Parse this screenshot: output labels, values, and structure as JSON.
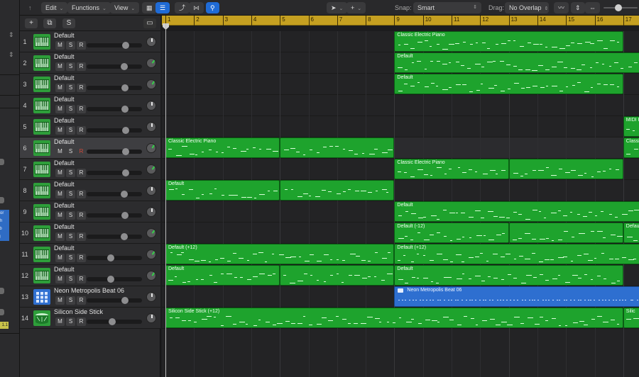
{
  "toolbar": {
    "edit": "Edit",
    "functions": "Functions",
    "view": "View",
    "snap_label": "Snap:",
    "snap_value": "Smart",
    "drag_label": "Drag:",
    "drag_value": "No Overlap"
  },
  "header_bar": {
    "add": "+",
    "duplicate": "⧉",
    "solo": "S"
  },
  "buttons": {
    "mute": "M",
    "solo": "S",
    "record": "R"
  },
  "strip": {
    "blue_labels": [
      "ssor",
      "itch",
      "erb",
      "ng"
    ],
    "yellow_label": "1.1"
  },
  "ruler": {
    "bars": [
      "1",
      "2",
      "3",
      "4",
      "5",
      "6",
      "7",
      "8",
      "9",
      "10",
      "11",
      "12",
      "13",
      "14",
      "15",
      "16",
      "17"
    ]
  },
  "tracks": [
    {
      "num": "1",
      "name": "Default",
      "icon": "keyboard-icon",
      "fader": 0.74,
      "pan": 0
    },
    {
      "num": "2",
      "name": "Default",
      "icon": "keyboard-icon",
      "fader": 0.7,
      "pan": 35
    },
    {
      "num": "3",
      "name": "Default",
      "icon": "keyboard-icon",
      "fader": 0.72,
      "pan": 30
    },
    {
      "num": "4",
      "name": "Default",
      "icon": "keyboard-icon",
      "fader": 0.72,
      "pan": 0
    },
    {
      "num": "5",
      "name": "Default",
      "icon": "keyboard-icon",
      "fader": 0.74,
      "pan": 0
    },
    {
      "num": "6",
      "name": "Default",
      "icon": "keyboard-icon",
      "fader": 0.74,
      "pan": 30,
      "selected": true
    },
    {
      "num": "7",
      "name": "Default",
      "icon": "keyboard-icon",
      "fader": 0.74,
      "pan": 35
    },
    {
      "num": "8",
      "name": "Default",
      "icon": "keyboard-icon",
      "fader": 0.7,
      "pan": 0
    },
    {
      "num": "9",
      "name": "Default",
      "icon": "keyboard-icon",
      "fader": 0.72,
      "pan": 0
    },
    {
      "num": "10",
      "name": "Default",
      "icon": "keyboard-icon",
      "fader": 0.7,
      "pan": 35
    },
    {
      "num": "11",
      "name": "Default",
      "icon": "keyboard-icon",
      "fader": 0.42,
      "pan": 35
    },
    {
      "num": "12",
      "name": "Default",
      "icon": "keyboard-icon",
      "fader": 0.42,
      "pan": 30
    },
    {
      "num": "13",
      "name": "Neon Metropolis Beat 06",
      "icon": "drum-machine-icon",
      "fader": 0.72,
      "pan": 0
    },
    {
      "num": "14",
      "name": "Silicon Side Stick",
      "icon": "snare-drum-icon",
      "fader": 0.45,
      "pan": 0
    }
  ],
  "regions": [
    {
      "track": 0,
      "start": 9,
      "end": 17,
      "name": "Classic Electric Piano",
      "color": "green"
    },
    {
      "track": 1,
      "start": 9,
      "end": 17.6,
      "name": "Default",
      "color": "green"
    },
    {
      "track": 2,
      "start": 9,
      "end": 17,
      "name": "Default",
      "color": "green"
    },
    {
      "track": 4,
      "start": 17,
      "end": 17.6,
      "name": "MIDI R",
      "color": "green"
    },
    {
      "track": 5,
      "start": 1,
      "end": 5,
      "name": "Classic Electric Piano",
      "color": "green"
    },
    {
      "track": 5,
      "start": 5,
      "end": 9,
      "name": "",
      "color": "green"
    },
    {
      "track": 5,
      "start": 17,
      "end": 17.6,
      "name": "Classi",
      "color": "green"
    },
    {
      "track": 6,
      "start": 9,
      "end": 13,
      "name": "Classic Electric Piano",
      "color": "green"
    },
    {
      "track": 6,
      "start": 13,
      "end": 17,
      "name": "",
      "color": "green"
    },
    {
      "track": 7,
      "start": 1,
      "end": 5,
      "name": "Default",
      "color": "green"
    },
    {
      "track": 7,
      "start": 5,
      "end": 9,
      "name": "",
      "color": "green"
    },
    {
      "track": 8,
      "start": 9,
      "end": 17.6,
      "name": "Default",
      "color": "green"
    },
    {
      "track": 9,
      "start": 9,
      "end": 13,
      "name": "Default (-12)",
      "color": "green"
    },
    {
      "track": 9,
      "start": 13,
      "end": 17,
      "name": "",
      "color": "green"
    },
    {
      "track": 9,
      "start": 17,
      "end": 17.6,
      "name": "Defau",
      "color": "green"
    },
    {
      "track": 10,
      "start": 1,
      "end": 9,
      "name": "Default (+12)",
      "color": "green"
    },
    {
      "track": 10,
      "start": 9,
      "end": 17.6,
      "name": "Default (+12)",
      "color": "green"
    },
    {
      "track": 11,
      "start": 1,
      "end": 5,
      "name": "Default",
      "color": "green"
    },
    {
      "track": 11,
      "start": 5,
      "end": 9,
      "name": "",
      "color": "green"
    },
    {
      "track": 11,
      "start": 9,
      "end": 17,
      "name": "Default",
      "color": "green"
    },
    {
      "track": 12,
      "start": 9,
      "end": 17.6,
      "name": "Neon Metropolis Beat 06",
      "color": "blue"
    },
    {
      "track": 13,
      "start": 1,
      "end": 17,
      "name": "Silicon Side Stick (+12)",
      "color": "green"
    },
    {
      "track": 13,
      "start": 17,
      "end": 17.6,
      "name": "Silic",
      "color": "green"
    }
  ]
}
